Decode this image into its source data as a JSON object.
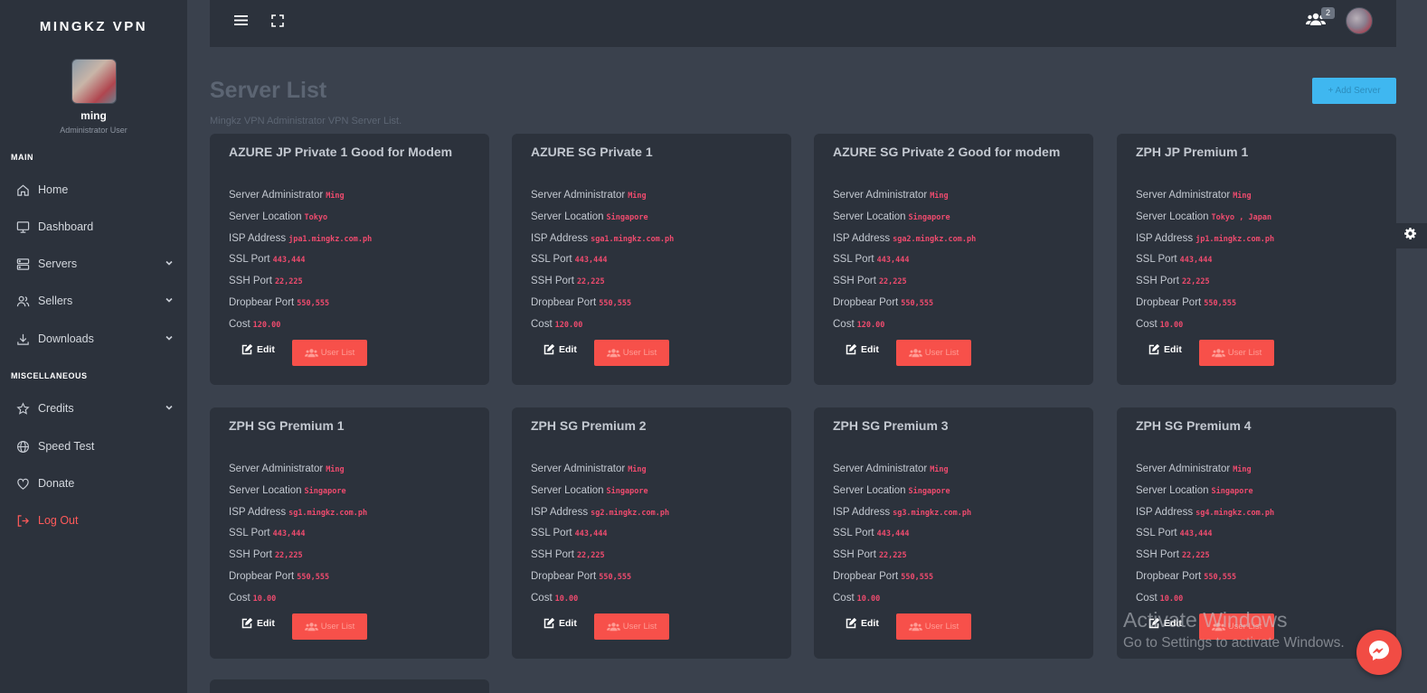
{
  "sidebar": {
    "brand": "MINGKZ VPN",
    "profile": {
      "name": "ming",
      "role": "Administrator User"
    },
    "sections": {
      "main": "MAIN",
      "misc": "MISCELLANEOUS"
    },
    "items": [
      {
        "label": "Home",
        "icon": "home-icon"
      },
      {
        "label": "Dashboard",
        "icon": "monitor-icon"
      },
      {
        "label": "Servers",
        "icon": "server-icon"
      },
      {
        "label": "Sellers",
        "icon": "users-icon"
      },
      {
        "label": "Downloads",
        "icon": "download-icon"
      },
      {
        "label": "Credits",
        "icon": "star-icon"
      },
      {
        "label": "Speed Test",
        "icon": "globe-icon"
      },
      {
        "label": "Donate",
        "icon": "heart-icon"
      },
      {
        "label": "Log Out",
        "icon": "logout-icon"
      }
    ]
  },
  "topbar": {
    "notification_count": "2"
  },
  "header": {
    "title": "Server List",
    "subtitle": "Mingkz VPN Administrator VPN Server List.",
    "add_button": "+ Add Server"
  },
  "field_labels": {
    "admin": "Server Administrator",
    "location": "Server Location",
    "isp": "ISP Address",
    "ssl": "SSL Port",
    "ssh": "SSH Port",
    "dropbear": "Dropbear Port",
    "cost": "Cost"
  },
  "actions": {
    "edit": "Edit",
    "user_list": "User List"
  },
  "servers": [
    {
      "name": "AZURE JP Private 1 Good for Modem",
      "admin": "Ming",
      "location": "Tokyo",
      "isp": "jpa1.mingkz.com.ph",
      "ssl": "443,444",
      "ssh": "22,225",
      "dropbear": "550,555",
      "cost": "120.00"
    },
    {
      "name": "AZURE SG Private 1",
      "admin": "Ming",
      "location": "Singapore",
      "isp": "sga1.mingkz.com.ph",
      "ssl": "443,444",
      "ssh": "22,225",
      "dropbear": "550,555",
      "cost": "120.00"
    },
    {
      "name": "AZURE SG Private 2 Good for modem",
      "admin": "Ming",
      "location": "Singapore",
      "isp": "sga2.mingkz.com.ph",
      "ssl": "443,444",
      "ssh": "22,225",
      "dropbear": "550,555",
      "cost": "120.00"
    },
    {
      "name": "ZPH JP Premium 1",
      "admin": "Ming",
      "location": "Tokyo , Japan",
      "isp": "jp1.mingkz.com.ph",
      "ssl": "443,444",
      "ssh": "22,225",
      "dropbear": "550,555",
      "cost": "10.00"
    },
    {
      "name": "ZPH SG Premium 1",
      "admin": "Ming",
      "location": "Singapore",
      "isp": "sg1.mingkz.com.ph",
      "ssl": "443,444",
      "ssh": "22,225",
      "dropbear": "550,555",
      "cost": "10.00"
    },
    {
      "name": "ZPH SG Premium 2",
      "admin": "Ming",
      "location": "Singapore",
      "isp": "sg2.mingkz.com.ph",
      "ssl": "443,444",
      "ssh": "22,225",
      "dropbear": "550,555",
      "cost": "10.00"
    },
    {
      "name": "ZPH SG Premium 3",
      "admin": "Ming",
      "location": "Singapore",
      "isp": "sg3.mingkz.com.ph",
      "ssl": "443,444",
      "ssh": "22,225",
      "dropbear": "550,555",
      "cost": "10.00"
    },
    {
      "name": "ZPH SG Premium 4",
      "admin": "Ming",
      "location": "Singapore",
      "isp": "sg4.mingkz.com.ph",
      "ssl": "443,444",
      "ssh": "22,225",
      "dropbear": "550,555",
      "cost": "10.00"
    }
  ],
  "watermark": {
    "line1": "Activate Windows",
    "line2": "Go to Settings to activate Windows."
  },
  "colors": {
    "background": "#3a414d",
    "panel": "#2c323c",
    "accent_red": "#f7504a",
    "value_pink": "#ef4b6e",
    "button_blue": "#3fb7f0"
  }
}
